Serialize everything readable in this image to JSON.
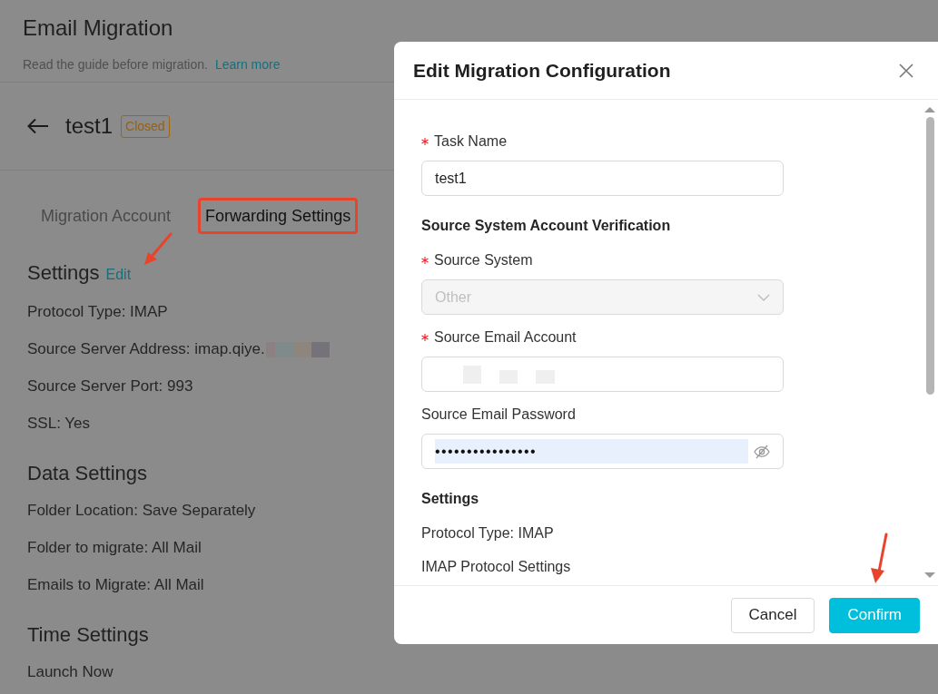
{
  "page": {
    "title": "Email Migration",
    "subtitle": "Read the guide before migration.",
    "learn_more": "Learn more"
  },
  "task": {
    "name": "test1",
    "status": "Closed"
  },
  "tabs": [
    {
      "label": "Migration Account",
      "selected": false,
      "annotated": false
    },
    {
      "label": "Forwarding Settings",
      "selected": true,
      "annotated": true
    }
  ],
  "sections": [
    {
      "title": "Settings",
      "edit": {
        "label": "Edit",
        "annotated": true
      },
      "lines": [
        {
          "text": "Protocol Type: IMAP",
          "redacted": false
        },
        {
          "text": "Source Server Address: imap.qiye.",
          "redacted": true
        },
        {
          "text": "Source Server Port: 993",
          "redacted": false
        },
        {
          "text": "SSL: Yes",
          "redacted": false
        }
      ]
    },
    {
      "title": "Data Settings",
      "lines": [
        {
          "text": "Folder Location: Save Separately",
          "redacted": false
        },
        {
          "text": "Folder to migrate: All Mail",
          "redacted": false
        },
        {
          "text": "Emails to Migrate: All Mail",
          "redacted": false
        }
      ]
    },
    {
      "title": "Time Settings",
      "lines": [
        {
          "text": "Launch Now",
          "redacted": false
        }
      ]
    }
  ],
  "dialog": {
    "title": "Edit Migration Configuration",
    "fields": [
      {
        "kind": "text",
        "label": "Task Name",
        "required": true,
        "value": "test1"
      },
      {
        "kind": "heading",
        "label": "Source System Account Verification"
      },
      {
        "kind": "select",
        "label": "Source System",
        "required": true,
        "value": "Other",
        "disabled": true
      },
      {
        "kind": "redacted",
        "label": "Source Email Account",
        "required": true
      },
      {
        "kind": "password",
        "label": "Source Email Password",
        "required": false,
        "value": "••••••••••••••••",
        "highlighted": true
      },
      {
        "kind": "heading",
        "label": "Settings"
      },
      {
        "kind": "line",
        "label": "Protocol Type: IMAP"
      },
      {
        "kind": "line",
        "label": "IMAP Protocol Settings"
      }
    ],
    "buttons": [
      {
        "label": "Cancel",
        "kind": "secondary",
        "annotated": false
      },
      {
        "label": "Confirm",
        "kind": "primary",
        "annotated": true
      }
    ]
  }
}
